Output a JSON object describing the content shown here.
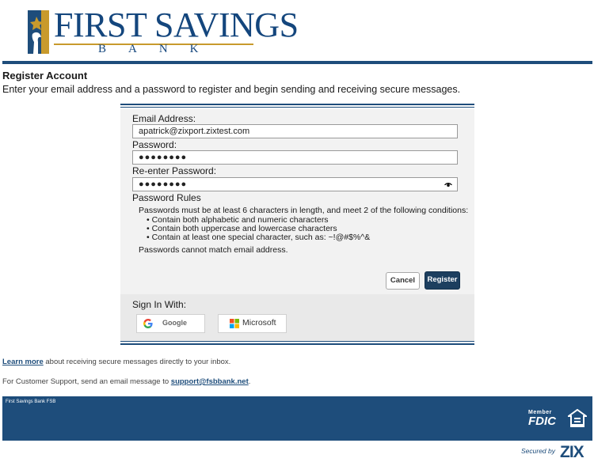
{
  "brand": {
    "name": "FIRST SAVINGS",
    "sub": "BANK",
    "colors": {
      "navy": "#1e4d7b",
      "gold": "#c89a2c",
      "register_button": "#1d3f5f"
    }
  },
  "page": {
    "title": "Register Account",
    "intro": "Enter your email address and a password to register and begin sending and receiving secure messages."
  },
  "form": {
    "email_label": "Email Address:",
    "email_value": "apatrick@zixport.zixtest.com",
    "password_label": "Password:",
    "password_mask": "●●●●●●●●",
    "reenter_label": "Re-enter Password:",
    "reenter_mask": "●●●●●●●●",
    "show_password_icon": "eye-icon"
  },
  "rules": {
    "title": "Password Rules",
    "intro": "Passwords must be at least 6 characters in length, and meet 2 of the following conditions:",
    "items": [
      "Contain both alphabetic and numeric characters",
      "Contain both uppercase and lowercase characters",
      "Contain at least one special character, such as: ~!@#$%^&"
    ],
    "note": "Passwords cannot match email address."
  },
  "buttons": {
    "cancel": "Cancel",
    "register": "Register"
  },
  "signin": {
    "label": "Sign In With:",
    "google": "Google",
    "microsoft": "Microsoft"
  },
  "info": {
    "learn_more_link": "Learn more",
    "learn_more_rest": " about receiving secure messages directly to your inbox.",
    "support_prefix": "For Customer Support, send an email message to ",
    "support_email": "support@fsbbank.net",
    "support_suffix": "."
  },
  "footer": {
    "bank_name": "First Savings Bank FSB",
    "fdic_member": "Member",
    "fdic_text": "FDIC",
    "equal_housing_icon": "equal-housing-lender-icon",
    "secured_by": "Secured by",
    "zix": "ZIX"
  }
}
